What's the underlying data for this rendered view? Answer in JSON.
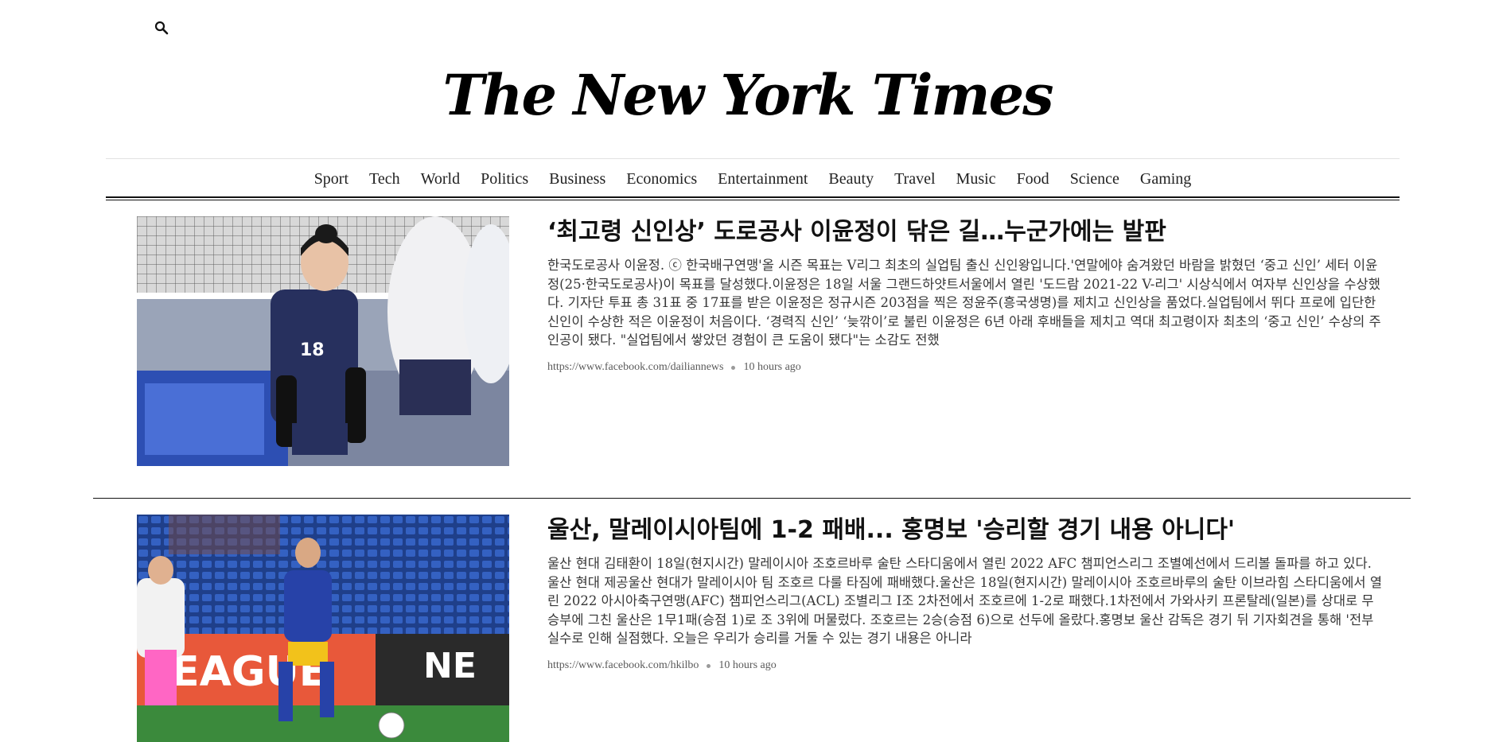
{
  "header": {
    "search_icon": "search-icon",
    "logo_text": "The New York Times"
  },
  "nav": {
    "items": [
      {
        "label": "Sport"
      },
      {
        "label": "Tech"
      },
      {
        "label": "World"
      },
      {
        "label": "Politics"
      },
      {
        "label": "Business"
      },
      {
        "label": "Economics"
      },
      {
        "label": "Entertainment"
      },
      {
        "label": "Beauty"
      },
      {
        "label": "Travel"
      },
      {
        "label": "Music"
      },
      {
        "label": "Food"
      },
      {
        "label": "Science"
      },
      {
        "label": "Gaming"
      }
    ]
  },
  "articles": [
    {
      "headline": "‘최고령 신인상’ 도로공사 이윤정이 닦은 길…누군가에는 발판",
      "summary": "한국도로공사 이윤정. ⓒ 한국배구연맹'올 시즌 목표는 V리그 최초의 실업팀 출신 신인왕입니다.'연말에야 숨겨왔던 바람을 밝혔던 ‘중고 신인’ 세터 이윤정(25·한국도로공사)이 목표를 달성했다.이윤정은 18일 서울 그랜드하얏트서울에서 열린 '도드람 2021-22 V-리그' 시상식에서 여자부 신인상을 수상했다. 기자단 투표 총 31표 중 17표를 받은 이윤정은 정규시즌 203점을 찍은 정윤주(흥국생명)를 제치고 신인상을 품었다.실업팀에서 뛰다 프로에 입단한 신인이 수상한 적은 이윤정이 처음이다. ‘경력직 신인’ ‘늦깎이’로 불린 이윤정은 6년 아래 후배들을 제치고 역대 최고령이자 최초의 ‘중고 신인’ 수상의 주인공이 됐다. \"실업팀에서 쌓았던 경험이 큰 도움이 됐다\"는 소감도 전했",
      "source": "https://www.facebook.com/dailiannews",
      "time": "10 hours ago",
      "image_icon": "volleyball-player-photo"
    },
    {
      "headline": "울산, 말레이시아팀에 1-2 패배... 홍명보 '승리할 경기 내용 아니다'",
      "summary": "울산 현대 김태환이 18일(현지시간) 말레이시아 조호르바루 술탄 스타디움에서 열린 2022 AFC 챔피언스리그 조별예선에서 드리볼 돌파를 하고 있다. 울산 현대 제공울산 현대가 말레이시아 팀 조호르 다룰 타짐에 패배했다.울산은 18일(현지시간) 말레이시아 조호르바루의 술탄 이브라힘 스타디움에서 열린 2022 아시아축구연맹(AFC) 챔피언스리그(ACL) 조별리그 I조 2차전에서 조호르에 1-2로 패했다.1차전에서 가와사키 프론탈레(일본)를 상대로 무승부에 그친 울산은 1무1패(승점 1)로 조 3위에 머물렀다. 조호르는 2승(승점 6)으로 선두에 올랐다.홍명보 울산 감독은 경기 뒤 기자회견을 통해 '전부 실수로 인해 실점했다. 오늘은 우리가 승리를 거둘 수 있는 경기 내용은 아니라",
      "source": "https://www.facebook.com/hkilbo",
      "time": "10 hours ago",
      "image_icon": "soccer-player-photo"
    }
  ]
}
